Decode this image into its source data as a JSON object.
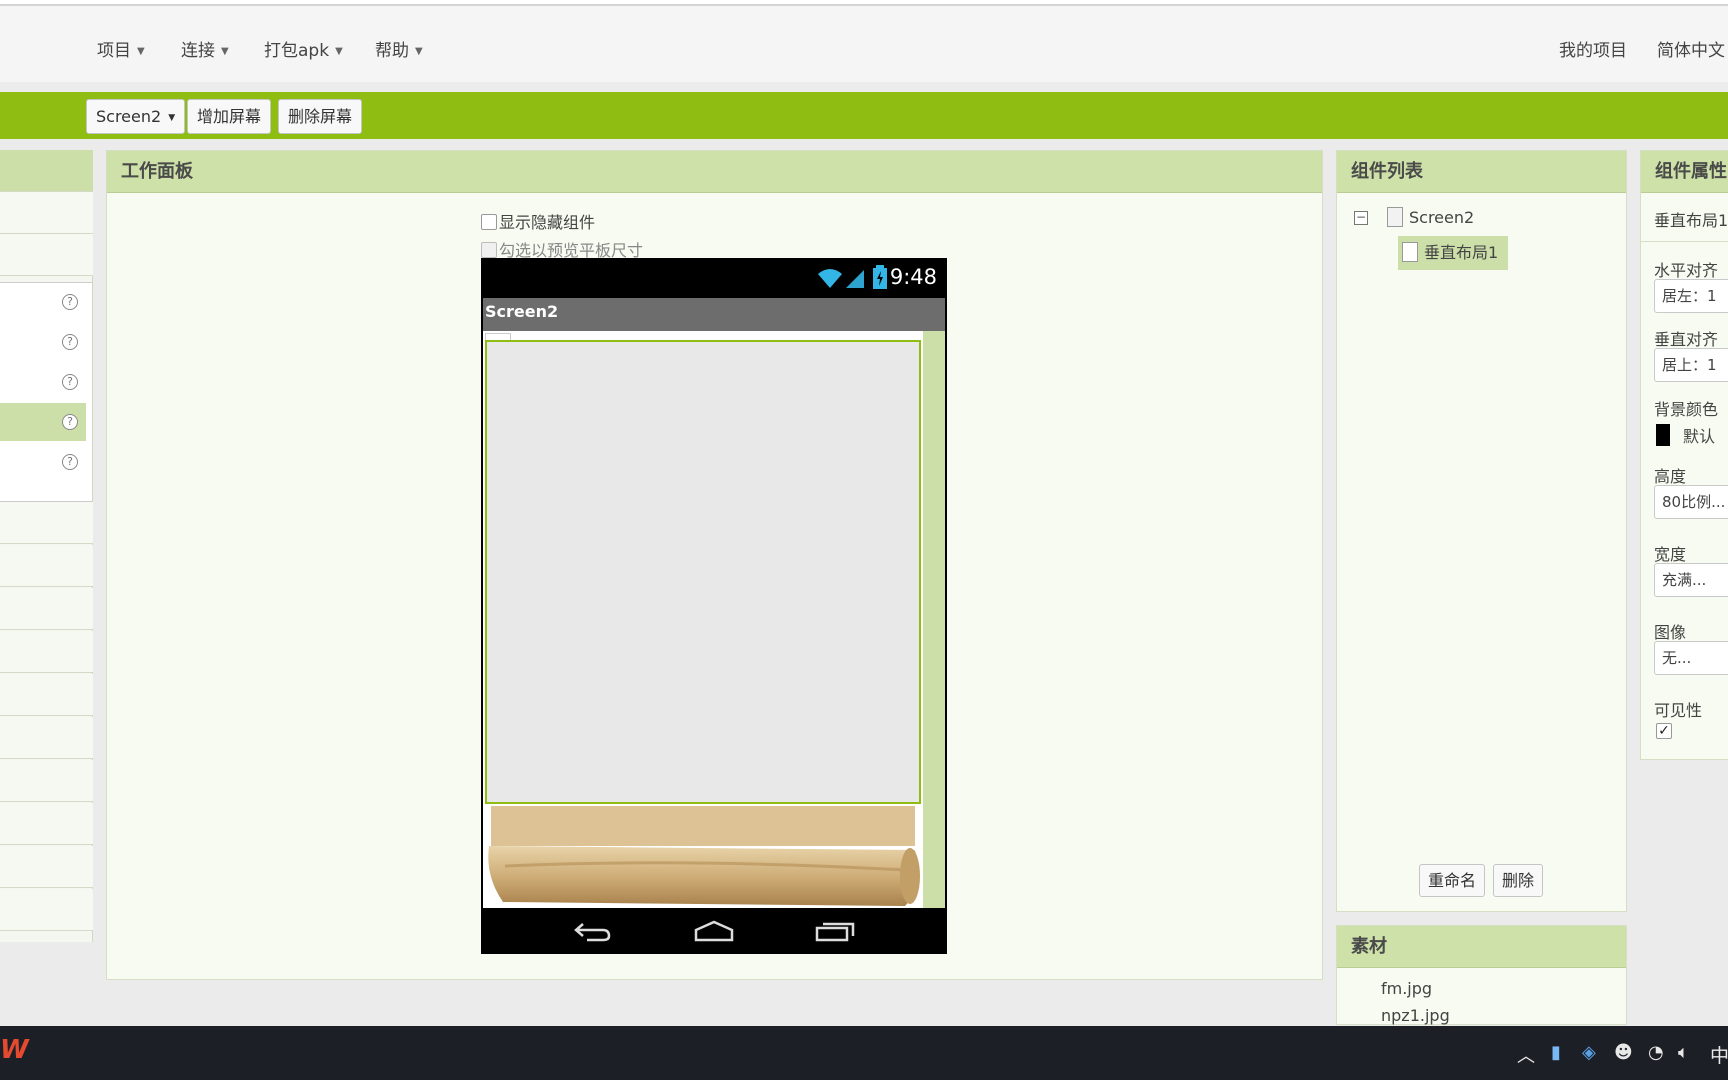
{
  "menu": {
    "items": [
      "项目",
      "连接",
      "打包apk",
      "帮助"
    ],
    "my_projects": "我的项目",
    "language": "简体中文"
  },
  "toolbar": {
    "screen_select": "Screen2",
    "add_screen": "增加屏幕",
    "remove_screen": "删除屏幕"
  },
  "workpanel": {
    "title": "工作面板",
    "show_hidden": "显示隐藏组件",
    "tablet_preview": "勾选以预览平板尺寸"
  },
  "phone": {
    "time": "9:48",
    "screen_title": "Screen2"
  },
  "components": {
    "title": "组件列表",
    "root": "Screen2",
    "selected": "垂直布局1",
    "rename": "重命名",
    "delete": "删除"
  },
  "media": {
    "title": "素材",
    "files": [
      "fm.jpg",
      "npz1.jpg"
    ]
  },
  "properties": {
    "title": "组件属性",
    "component": "垂直布局1",
    "halign_label": "水平对齐",
    "halign_value": "居左：1",
    "valign_label": "垂直对齐",
    "valign_value": "居上：1",
    "bgcolor_label": "背景颜色",
    "bgcolor_value": "默认",
    "height_label": "高度",
    "height_value": "80比例...",
    "width_label": "宽度",
    "width_value": "充满...",
    "image_label": "图像",
    "image_value": "无...",
    "visible_label": "可见性",
    "visible_checked": true
  },
  "taskbar": {
    "ime": "中"
  },
  "colors": {
    "accent_green": "#8fbd12",
    "panel_header": "#cde1a8",
    "selection": "#cddfa9"
  }
}
